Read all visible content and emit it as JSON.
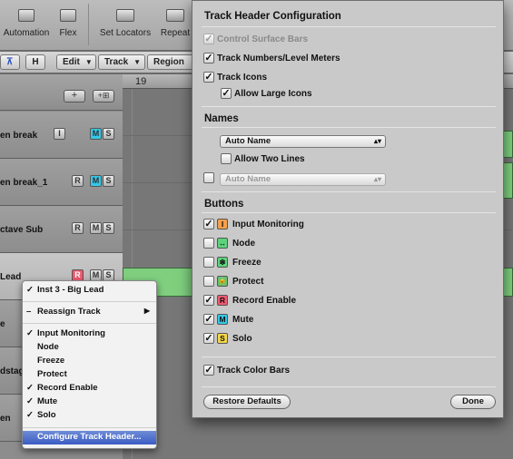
{
  "toolbar": {
    "items": [
      {
        "label": "Automation"
      },
      {
        "label": "Flex"
      },
      {
        "label": "Set Locators"
      },
      {
        "label": "Repeat"
      }
    ]
  },
  "local_menu": {
    "btn1": "⊼",
    "btn2": "H",
    "edit": "Edit",
    "track": "Track",
    "region": "Region",
    "arrow": "▼"
  },
  "tracklist": {
    "add_button": "+",
    "add_multi_button": "+⊞",
    "tracks": [
      {
        "name": "en break"
      },
      {
        "name": "en break_1"
      },
      {
        "name": "ctave Sub"
      },
      {
        "name": "Lead"
      },
      {
        "name": "e"
      },
      {
        "name": "dstag"
      },
      {
        "name": "en"
      }
    ]
  },
  "arrange": {
    "ruler_number": "19"
  },
  "context_menu": {
    "items": [
      {
        "check": "✓",
        "label": "Inst 3 - Big Lead"
      },
      {
        "check": "–",
        "label": "Reassign Track",
        "submenu": "▶"
      },
      {
        "check": "✓",
        "label": "Input Monitoring"
      },
      {
        "check": "",
        "label": "Node"
      },
      {
        "check": "",
        "label": "Freeze"
      },
      {
        "check": "",
        "label": "Protect"
      },
      {
        "check": "✓",
        "label": "Record Enable"
      },
      {
        "check": "✓",
        "label": "Mute"
      },
      {
        "check": "✓",
        "label": "Solo"
      },
      {
        "check": "",
        "label": "Configure Track Header..."
      }
    ]
  },
  "panel": {
    "title": "Track Header Configuration",
    "control_surface_bars": {
      "label": "Control Surface Bars",
      "checked": "✓"
    },
    "track_numbers": {
      "label": "Track Numbers/Level Meters",
      "checked": "✓"
    },
    "track_icons": {
      "label": "Track Icons",
      "checked": "✓"
    },
    "allow_large_icons": {
      "label": "Allow Large Icons",
      "checked": "✓"
    },
    "names_title": "Names",
    "name_select_1": "Auto Name",
    "allow_two_lines": {
      "label": "Allow Two Lines",
      "checked": ""
    },
    "name_select_2": "Auto Name",
    "second_name": {
      "checked": ""
    },
    "select_arrows": "▴▾",
    "buttons_title": "Buttons",
    "buttons": [
      {
        "label": "Input Monitoring",
        "checked": "✓",
        "icon_glyph": "I",
        "icon_color": "#f5a04a",
        "icon_name": "input-monitoring-icon"
      },
      {
        "label": "Node",
        "checked": "",
        "icon_glyph": "↔",
        "icon_color": "#5ed37c",
        "icon_name": "node-icon"
      },
      {
        "label": "Freeze",
        "checked": "",
        "icon_glyph": "❄",
        "icon_color": "#5ed37c",
        "icon_name": "freeze-icon"
      },
      {
        "label": "Protect",
        "checked": "",
        "icon_glyph": "🔒",
        "icon_color": "#6ac46a",
        "icon_name": "lock-icon"
      },
      {
        "label": "Record Enable",
        "checked": "✓",
        "icon_glyph": "R",
        "icon_color": "#f05a70",
        "icon_name": "record-icon"
      },
      {
        "label": "Mute",
        "checked": "✓",
        "icon_glyph": "M",
        "icon_color": "#35c9e8",
        "icon_name": "mute-icon"
      },
      {
        "label": "Solo",
        "checked": "✓",
        "icon_glyph": "S",
        "icon_color": "#f4d64a",
        "icon_name": "solo-icon"
      }
    ],
    "track_color_bars": {
      "label": "Track Color Bars",
      "checked": "✓"
    },
    "restore_defaults": "Restore Defaults",
    "done": "Done"
  }
}
